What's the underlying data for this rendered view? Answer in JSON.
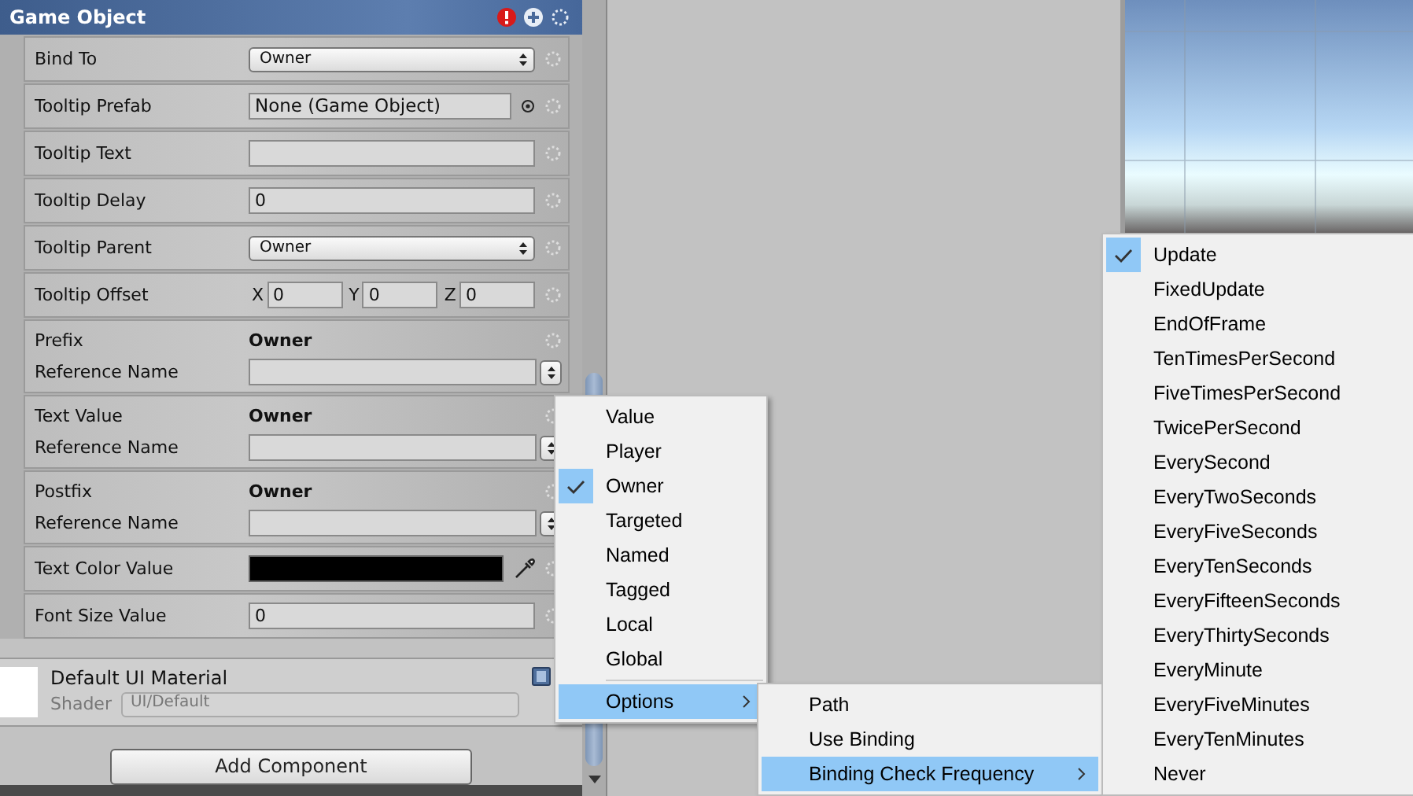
{
  "component": {
    "title": "Game Object"
  },
  "fields": [
    {
      "kind": "dropdown",
      "label": "Bind To",
      "value": "Owner"
    },
    {
      "kind": "object",
      "label": "Tooltip Prefab",
      "value": "None (Game Object)"
    },
    {
      "kind": "text",
      "label": "Tooltip Text"
    },
    {
      "kind": "text",
      "label": "Tooltip Delay",
      "value": "0"
    },
    {
      "kind": "dropdown",
      "label": "Tooltip Parent",
      "value": "Owner"
    },
    {
      "kind": "vector",
      "label": "Tooltip Offset",
      "axes": [
        {
          "axis": "X",
          "value": "0"
        },
        {
          "axis": "Y",
          "value": "0"
        },
        {
          "axis": "Z",
          "value": "0"
        }
      ]
    },
    {
      "kind": "binding",
      "label": "Prefix",
      "binding": "Owner",
      "sublabel": "Reference Name"
    },
    {
      "kind": "binding",
      "label": "Text Value",
      "binding": "Owner",
      "sublabel": "Reference Name"
    },
    {
      "kind": "binding",
      "label": "Postfix",
      "binding": "Owner",
      "sublabel": "Reference Name"
    },
    {
      "kind": "color",
      "label": "Text Color Value",
      "color": "#000000"
    },
    {
      "kind": "text",
      "label": "Font Size Value",
      "value": "0"
    }
  ],
  "material": {
    "name": "Default UI Material",
    "shader_label": "Shader",
    "shader": "UI/Default"
  },
  "add_component_button": "Add Component",
  "binding_menu": {
    "items": [
      {
        "label": "Value",
        "selected": false
      },
      {
        "label": "Player",
        "selected": false
      },
      {
        "label": "Owner",
        "selected": true
      },
      {
        "label": "Targeted",
        "selected": false
      },
      {
        "label": "Named",
        "selected": false
      },
      {
        "label": "Tagged",
        "selected": false
      },
      {
        "label": "Local",
        "selected": false
      },
      {
        "label": "Global",
        "selected": false
      }
    ],
    "submenu": {
      "label": "Options",
      "highlighted": true
    }
  },
  "options_menu": {
    "items": [
      {
        "label": "Path",
        "kind": "item",
        "highlighted": false
      },
      {
        "label": "Use Binding",
        "kind": "item",
        "highlighted": false
      },
      {
        "label": "Binding Check Frequency",
        "kind": "submenu",
        "highlighted": true
      }
    ]
  },
  "frequency_menu": {
    "items": [
      {
        "label": "Update",
        "selected": true
      },
      {
        "label": "FixedUpdate",
        "selected": false
      },
      {
        "label": "EndOfFrame",
        "selected": false
      },
      {
        "label": "TenTimesPerSecond",
        "selected": false
      },
      {
        "label": "FiveTimesPerSecond",
        "selected": false
      },
      {
        "label": "TwicePerSecond",
        "selected": false
      },
      {
        "label": "EverySecond",
        "selected": false
      },
      {
        "label": "EveryTwoSeconds",
        "selected": false
      },
      {
        "label": "EveryFiveSeconds",
        "selected": false
      },
      {
        "label": "EveryTenSeconds",
        "selected": false
      },
      {
        "label": "EveryFifteenSeconds",
        "selected": false
      },
      {
        "label": "EveryThirtySeconds",
        "selected": false
      },
      {
        "label": "EveryMinute",
        "selected": false
      },
      {
        "label": "EveryFiveMinutes",
        "selected": false
      },
      {
        "label": "EveryTenMinutes",
        "selected": false
      },
      {
        "label": "Never",
        "selected": false
      }
    ]
  }
}
